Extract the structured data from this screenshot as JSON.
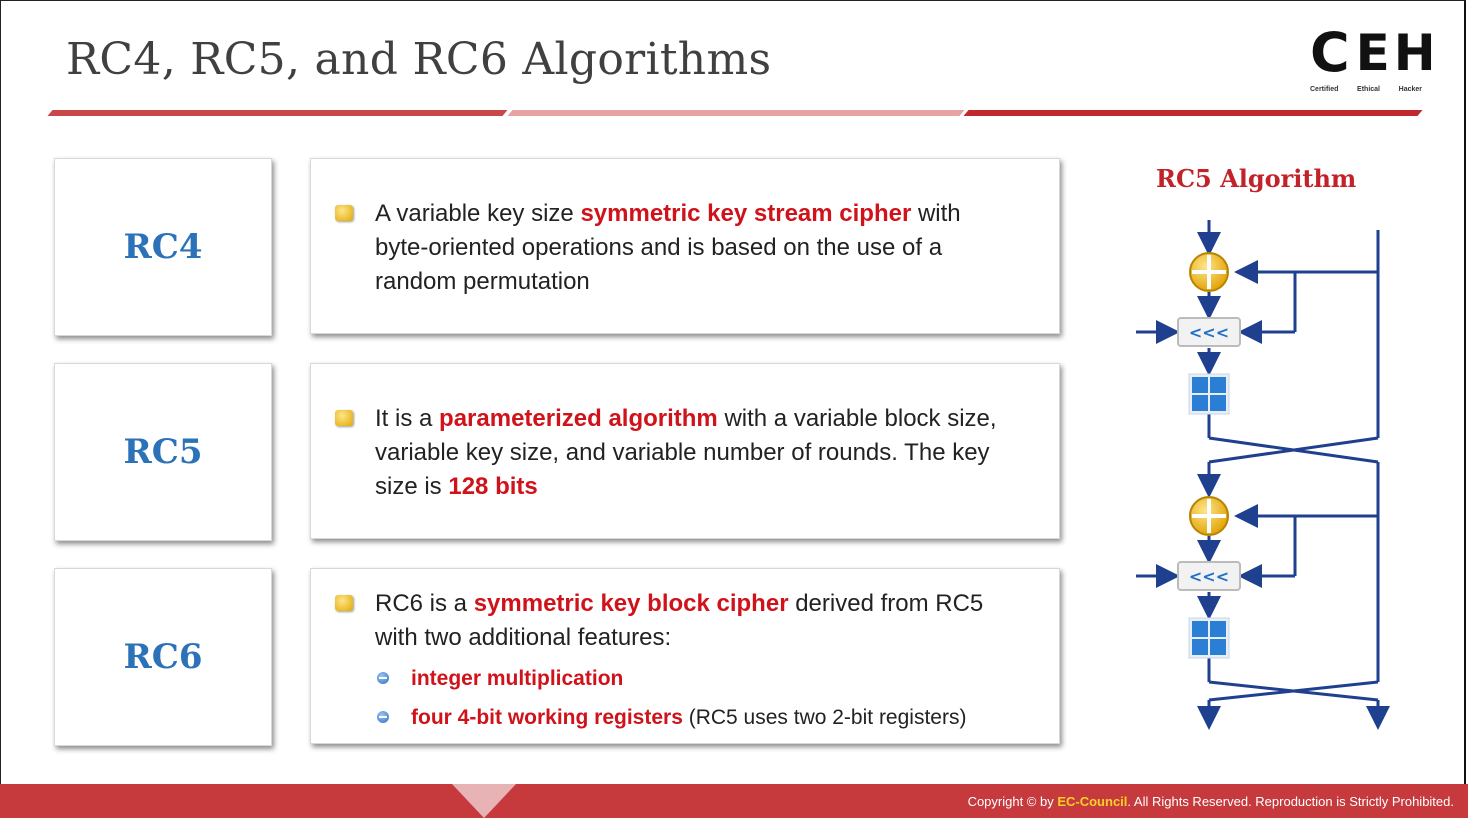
{
  "title": "RC4, RC5, and RC6 Algorithms",
  "logo": {
    "letters_c": "C",
    "letters_eh": "EH",
    "sub1": "Certified",
    "sub2": "Ethical",
    "sub3": "Hacker"
  },
  "rows": [
    {
      "label": "RC4",
      "parts": [
        "A variable key size ",
        "symmetric key stream cipher",
        " with byte-oriented operations and is based on the use of a random permutation"
      ]
    },
    {
      "label": "RC5",
      "parts": [
        "It is a ",
        "parameterized algorithm",
        " with a variable block size, variable key size, and variable number of rounds. The key size is ",
        "128 bits"
      ]
    },
    {
      "label": "RC6",
      "parts": [
        "RC6 is a ",
        "symmetric key block cipher",
        " derived from RC5 with two additional features:"
      ],
      "sub_items": [
        {
          "hl": "integer multiplication",
          "rest": ""
        },
        {
          "hl": "four 4-bit working registers",
          "rest": " (RC5 uses two 2-bit registers)"
        }
      ]
    }
  ],
  "diagram": {
    "title": "RC5 Algorithm",
    "rotate_symbol": "<<<",
    "colors": {
      "line": "#1f3f8f",
      "adder": "#f0b400",
      "block": "#2a7fd4"
    }
  },
  "footer": {
    "prefix": "Copyright © by ",
    "brand": "EC-Council",
    "suffix": ". All Rights Reserved. Reproduction is Strictly Prohibited."
  }
}
